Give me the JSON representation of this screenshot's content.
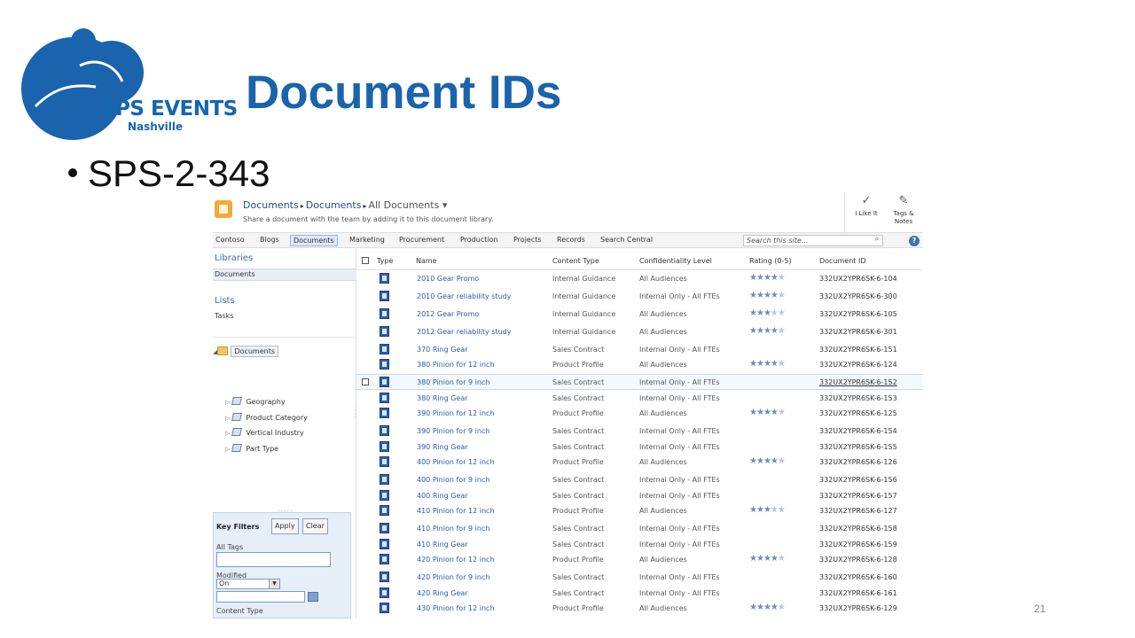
{
  "slide": {
    "logo_text": "SPS EVENTS",
    "logo_sub": "Nashville",
    "title": "Document IDs",
    "bullet": "SPS-2-343",
    "page_number": "21"
  },
  "colors": {
    "brand_blue": "#1a63ad",
    "highlight_yellow": "#f5f21e",
    "highlight_border": "#f0b51a",
    "link_blue": "#2a5ba8"
  },
  "sharepoint": {
    "breadcrumb": {
      "part1": "Documents",
      "part2": "Documents",
      "part3": "All Documents ▾"
    },
    "description": "Share a document with the team by adding it to this document library.",
    "actions": [
      {
        "icon": "like-icon",
        "label": "I Like It"
      },
      {
        "icon": "tags-notes-icon",
        "label": "Tags & Notes"
      }
    ],
    "nav": [
      "Contoso",
      "Blogs",
      "Documents",
      "Marketing",
      "Procurement",
      "Production",
      "Projects",
      "Records",
      "Search Central"
    ],
    "search_placeholder": "Search this site...",
    "help": "?",
    "quicklaunch": {
      "libraries_heading": "Libraries",
      "libraries_item": "Documents",
      "lists_heading": "Lists",
      "lists_item": "Tasks"
    },
    "tree": {
      "root": "Documents",
      "items": [
        "Geography",
        "Product Category",
        "Vertical Industry",
        "Part Type"
      ]
    },
    "dots": ".....",
    "key_filters": {
      "title": "Key Filters",
      "apply": "Apply",
      "clear": "Clear",
      "all_tags_label": "All Tags",
      "modified_label": "Modified",
      "modified_value": "On",
      "content_type_label": "Content Type"
    },
    "columns": {
      "type": "Type",
      "name": "Name",
      "content_type": "Content Type",
      "confidentiality": "Confidentiality Level",
      "rating": "Rating (0-5)",
      "doc_id": "Document ID"
    },
    "rows": [
      {
        "name": "2010 Gear Promo",
        "content_type": "Internal Guidance",
        "confidentiality": "All Audiences",
        "rating": 4,
        "doc_id": "332UX2YPR6SK-6-104"
      },
      {
        "name": "2010 Gear reliability study",
        "content_type": "Internal Guidance",
        "confidentiality": "Internal Only - All FTEs",
        "rating": 4,
        "doc_id": "332UX2YPR6SK-6-300"
      },
      {
        "name": "2012 Gear Promo",
        "content_type": "Internal Guidance",
        "confidentiality": "All Audiences",
        "rating": 3,
        "doc_id": "332UX2YPR6SK-6-105"
      },
      {
        "name": "2012 Gear reliability study",
        "content_type": "Internal Guidance",
        "confidentiality": "All Audiences",
        "rating": 4,
        "doc_id": "332UX2YPR6SK-6-301"
      },
      {
        "name": "370 Ring Gear",
        "content_type": "Sales Contract",
        "confidentiality": "Internal Only - All FTEs",
        "rating": 0,
        "doc_id": "332UX2YPR6SK-6-151"
      },
      {
        "name": "380 Pinion for 12 inch",
        "content_type": "Product Profile",
        "confidentiality": "All Audiences",
        "rating": 4,
        "doc_id": "332UX2YPR6SK-6-124"
      },
      {
        "name": "380 Pinion for 9 inch",
        "content_type": "Sales Contract",
        "confidentiality": "Internal Only - All FTEs",
        "rating": 0,
        "doc_id": "332UX2YPR6SK-6-152",
        "selected": true
      },
      {
        "name": "380 Ring Gear",
        "content_type": "Sales Contract",
        "confidentiality": "Internal Only - All FTEs",
        "rating": 0,
        "doc_id": "332UX2YPR6SK-6-153"
      },
      {
        "name": "390 Pinion for 12 inch",
        "content_type": "Product Profile",
        "confidentiality": "All Audiences",
        "rating": 4,
        "doc_id": "332UX2YPR6SK-6-125"
      },
      {
        "name": "390 Pinion for 9 inch",
        "content_type": "Sales Contract",
        "confidentiality": "Internal Only - All FTEs",
        "rating": 0,
        "doc_id": "332UX2YPR6SK-6-154"
      },
      {
        "name": "390 Ring Gear",
        "content_type": "Sales Contract",
        "confidentiality": "Internal Only - All FTEs",
        "rating": 0,
        "doc_id": "332UX2YPR6SK-6-155"
      },
      {
        "name": "400 Pinion for 12 inch",
        "content_type": "Product Profile",
        "confidentiality": "All Audiences",
        "rating": 4,
        "doc_id": "332UX2YPR6SK-6-126"
      },
      {
        "name": "400 Pinion for 9 inch",
        "content_type": "Sales Contract",
        "confidentiality": "Internal Only - All FTEs",
        "rating": 0,
        "doc_id": "332UX2YPR6SK-6-156"
      },
      {
        "name": "400 Ring Gear",
        "content_type": "Sales Contract",
        "confidentiality": "Internal Only - All FTEs",
        "rating": 0,
        "doc_id": "332UX2YPR6SK-6-157"
      },
      {
        "name": "410 Pinion for 12 inch",
        "content_type": "Product Profile",
        "confidentiality": "All Audiences",
        "rating": 3,
        "doc_id": "332UX2YPR6SK-6-127"
      },
      {
        "name": "410 Pinion for 9 inch",
        "content_type": "Sales Contract",
        "confidentiality": "Internal Only - All FTEs",
        "rating": 0,
        "doc_id": "332UX2YPR6SK-6-158"
      },
      {
        "name": "410 Ring Gear",
        "content_type": "Sales Contract",
        "confidentiality": "Internal Only - All FTEs",
        "rating": 0,
        "doc_id": "332UX2YPR6SK-6-159"
      },
      {
        "name": "420 Pinion for 12 inch",
        "content_type": "Product Profile",
        "confidentiality": "All Audiences",
        "rating": 4,
        "doc_id": "332UX2YPR6SK-6-128"
      },
      {
        "name": "420 Pinion for 9 inch",
        "content_type": "Sales Contract",
        "confidentiality": "Internal Only - All FTEs",
        "rating": 0,
        "doc_id": "332UX2YPR6SK-6-160"
      },
      {
        "name": "420 Ring Gear",
        "content_type": "Sales Contract",
        "confidentiality": "Internal Only - All FTEs",
        "rating": 0,
        "doc_id": "332UX2YPR6SK-6-161"
      },
      {
        "name": "430 Pinion for 12 inch",
        "content_type": "Product Profile",
        "confidentiality": "All Audiences",
        "rating": 4,
        "doc_id": "332UX2YPR6SK-6-129"
      }
    ]
  }
}
